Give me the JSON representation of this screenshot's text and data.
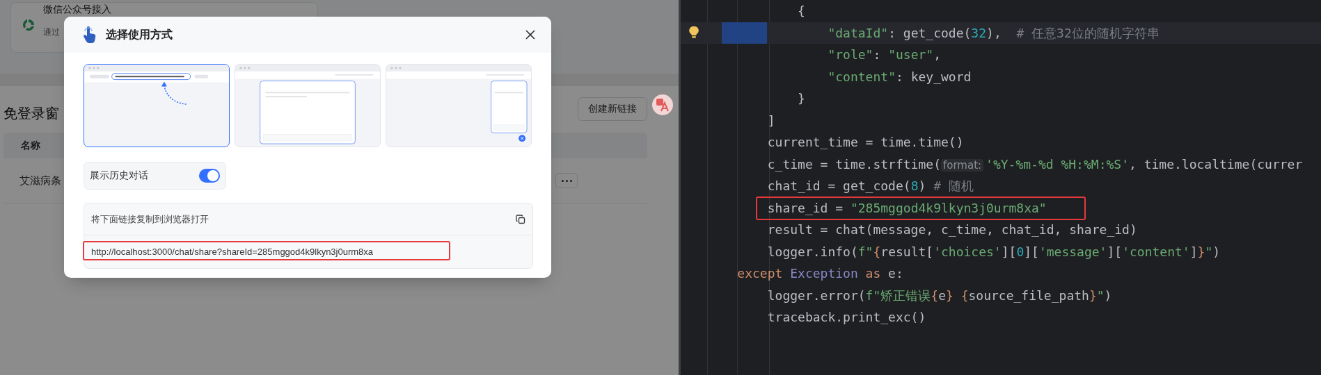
{
  "page": {
    "card": {
      "title": "微信公众号接入",
      "subtitle": "通过"
    },
    "section_title": "免登录窗",
    "create_button": "创建新链接",
    "table": {
      "columns": [
        "名称"
      ],
      "rows": [
        {
          "name": "艾滋病条"
        }
      ]
    }
  },
  "modal": {
    "title": "选择使用方式",
    "options": [
      {
        "kind": "address-bar",
        "selected": true
      },
      {
        "kind": "center-window",
        "selected": false
      },
      {
        "kind": "corner-bubble",
        "selected": false
      }
    ],
    "history_toggle": {
      "label": "展示历史对话",
      "on": true
    },
    "link": {
      "label": "将下面链接复制到浏览器打开",
      "url": "http://localhost:3000/chat/share?shareId=285mggod4k9lkyn3j0urm8xa",
      "highlighted": true
    }
  },
  "editor": {
    "lines": [
      {
        "tokens": [
          {
            "kind": "plain",
            "text": "            {"
          }
        ]
      },
      {
        "current": true,
        "selection": true,
        "bulb": true,
        "tokens": [
          {
            "kind": "string",
            "text": "                \"dataId\""
          },
          {
            "kind": "plain",
            "text": ": get_code("
          },
          {
            "kind": "number",
            "text": "32"
          },
          {
            "kind": "plain",
            "text": "),  "
          },
          {
            "kind": "comment",
            "text": "# 任意32位的随机字符串"
          }
        ]
      },
      {
        "tokens": [
          {
            "kind": "string",
            "text": "                \"role\""
          },
          {
            "kind": "plain",
            "text": ": "
          },
          {
            "kind": "string",
            "text": "\"user\""
          },
          {
            "kind": "plain",
            "text": ","
          }
        ]
      },
      {
        "tokens": [
          {
            "kind": "string",
            "text": "                \"content\""
          },
          {
            "kind": "plain",
            "text": ": key_word"
          }
        ]
      },
      {
        "tokens": [
          {
            "kind": "plain",
            "text": "            }"
          }
        ]
      },
      {
        "tokens": [
          {
            "kind": "plain",
            "text": "        ]"
          }
        ]
      },
      {
        "tokens": [
          {
            "kind": "plain",
            "text": "        current_time = time.time()"
          }
        ]
      },
      {
        "tokens": [
          {
            "kind": "plain",
            "text": "        c_time = time.strftime("
          },
          {
            "kind": "hint",
            "text": "format:"
          },
          {
            "kind": "string",
            "text": "'%Y-%m-%d %H:%M:%S'"
          },
          {
            "kind": "plain",
            "text": ", time.localtime(currer"
          }
        ]
      },
      {
        "tokens": [
          {
            "kind": "plain",
            "text": "        chat_id = get_code("
          },
          {
            "kind": "number",
            "text": "8"
          },
          {
            "kind": "plain",
            "text": ") "
          },
          {
            "kind": "comment",
            "text": "# 随机"
          }
        ]
      },
      {
        "framed": true,
        "tokens": [
          {
            "kind": "plain",
            "text": "        share_id = "
          },
          {
            "kind": "string",
            "text": "\"285mggod4k9lkyn3j0urm8xa\""
          }
        ]
      },
      {
        "tokens": [
          {
            "kind": "plain",
            "text": "        result = chat(message, c_time, chat_id, share_id)"
          }
        ]
      },
      {
        "tokens": [
          {
            "kind": "plain",
            "text": "        logger.info("
          },
          {
            "kind": "string",
            "text": "f\""
          },
          {
            "kind": "brace",
            "text": "{"
          },
          {
            "kind": "plain",
            "text": "result["
          },
          {
            "kind": "string",
            "text": "'choices'"
          },
          {
            "kind": "plain",
            "text": "]["
          },
          {
            "kind": "number",
            "text": "0"
          },
          {
            "kind": "plain",
            "text": "]["
          },
          {
            "kind": "string",
            "text": "'message'"
          },
          {
            "kind": "plain",
            "text": "]["
          },
          {
            "kind": "string",
            "text": "'content'"
          },
          {
            "kind": "plain",
            "text": "]"
          },
          {
            "kind": "brace",
            "text": "}"
          },
          {
            "kind": "string",
            "text": "\""
          },
          {
            "kind": "plain",
            "text": ")"
          }
        ]
      },
      {
        "tokens": [
          {
            "kind": "keyword",
            "text": "    except "
          },
          {
            "kind": "class",
            "text": "Exception"
          },
          {
            "kind": "keyword",
            "text": " as"
          },
          {
            "kind": "plain",
            "text": " e:"
          }
        ]
      },
      {
        "tokens": [
          {
            "kind": "plain",
            "text": "        logger.error("
          },
          {
            "kind": "string",
            "text": "f\"矫正错误"
          },
          {
            "kind": "brace",
            "text": "{"
          },
          {
            "kind": "plain",
            "text": "e"
          },
          {
            "kind": "brace",
            "text": "} {"
          },
          {
            "kind": "plain",
            "text": "source_file_path"
          },
          {
            "kind": "brace",
            "text": "}"
          },
          {
            "kind": "string",
            "text": "\""
          },
          {
            "kind": "plain",
            "text": ")"
          }
        ]
      },
      {
        "tokens": [
          {
            "kind": "plain",
            "text": "        traceback.print_exc()"
          }
        ]
      }
    ]
  }
}
